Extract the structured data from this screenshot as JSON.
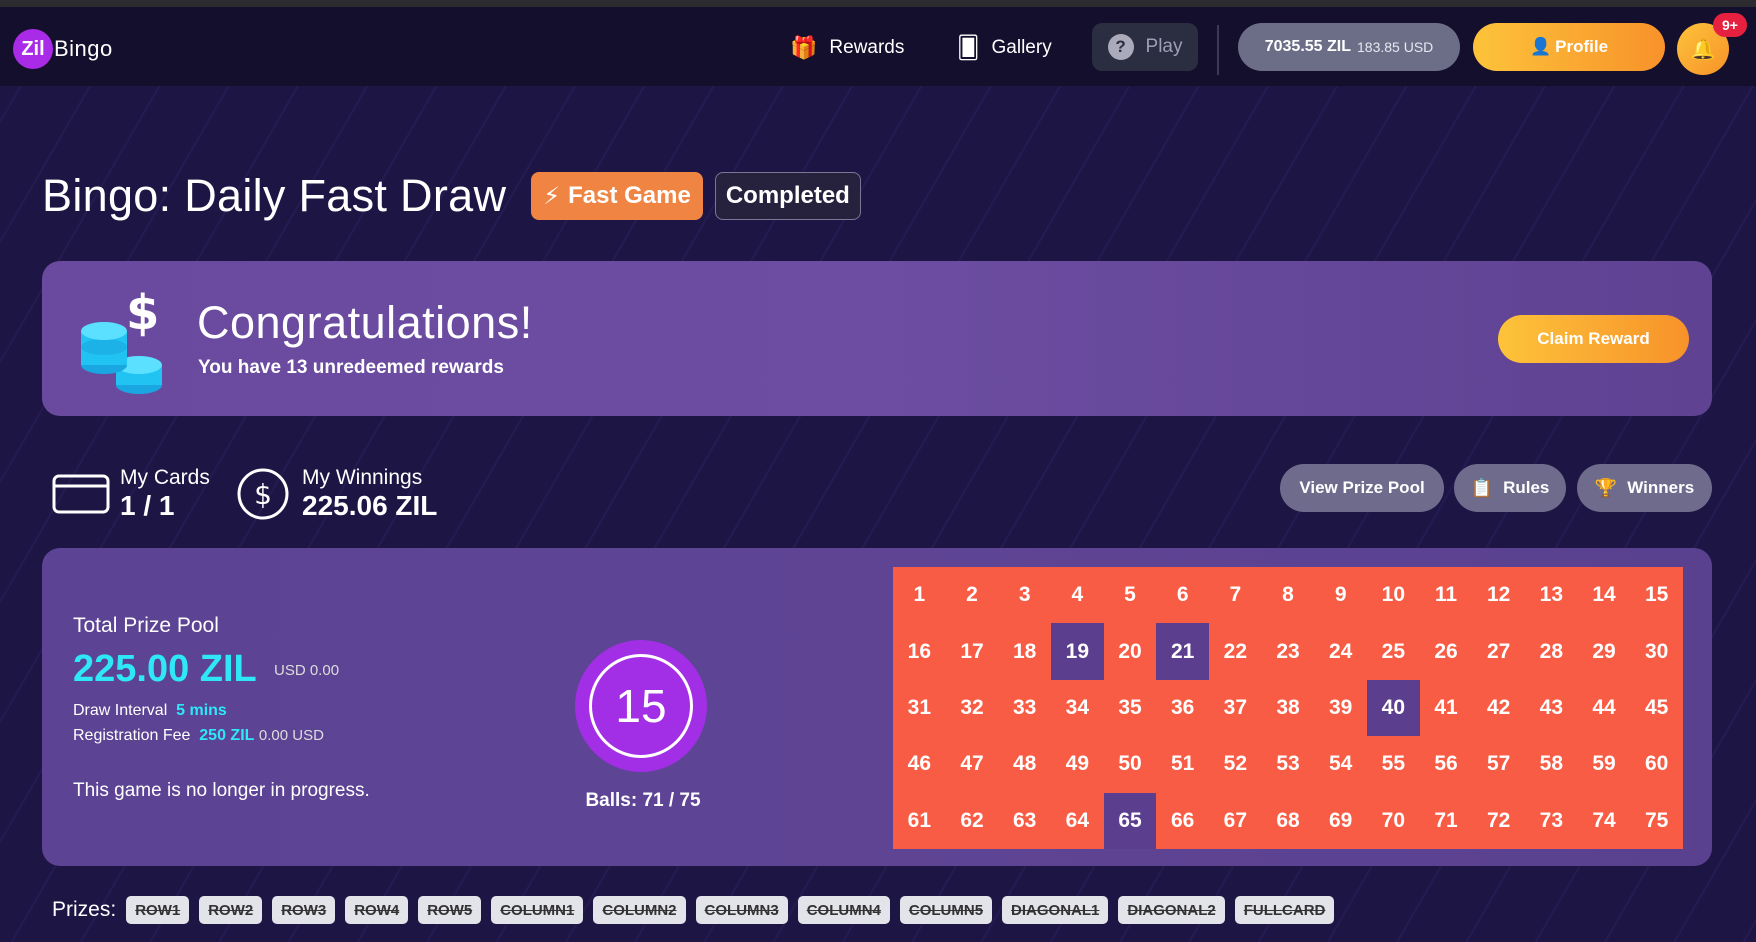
{
  "header": {
    "logo_prefix": "Zil",
    "logo_suffix": "Bingo",
    "nav": [
      {
        "label": "Rewards",
        "icon": "gift-icon"
      },
      {
        "label": "Gallery",
        "icon": "cards-icon"
      }
    ],
    "play_label": "Play",
    "balance_zil": "7035.55 ZIL",
    "balance_usd": "183.85 USD",
    "profile_label": "Profile",
    "notification_badge": "9+"
  },
  "page": {
    "title": "Bingo: Daily Fast Draw",
    "tag_fast": "Fast Game",
    "tag_status": "Completed"
  },
  "congrats": {
    "title": "Congratulations!",
    "subtitle": "You have 13 unredeemed rewards",
    "claim_label": "Claim Reward"
  },
  "stats": {
    "cards_label": "My Cards",
    "cards_value": "1 / 1",
    "winnings_label": "My Winnings",
    "winnings_value": "225.06 ZIL"
  },
  "actions": {
    "prize_pool_label": "View Prize Pool",
    "rules_label": "Rules",
    "winners_label": "Winners"
  },
  "game": {
    "pool_label": "Total Prize Pool",
    "pool_value": "225.00 ZIL",
    "pool_usd": "USD 0.00",
    "interval_label": "Draw Interval",
    "interval_value": "5 mins",
    "fee_label": "Registration Fee",
    "fee_value": "250 ZIL",
    "fee_usd": "0.00 USD",
    "status_text": "This game is no longer in progress.",
    "current_ball": "15",
    "balls_text": "Balls: 71 / 75",
    "board_numbers": [
      1,
      2,
      3,
      4,
      5,
      6,
      7,
      8,
      9,
      10,
      11,
      12,
      13,
      14,
      15,
      16,
      17,
      18,
      19,
      20,
      21,
      22,
      23,
      24,
      25,
      26,
      27,
      28,
      29,
      30,
      31,
      32,
      33,
      34,
      35,
      36,
      37,
      38,
      39,
      40,
      41,
      42,
      43,
      44,
      45,
      46,
      47,
      48,
      49,
      50,
      51,
      52,
      53,
      54,
      55,
      56,
      57,
      58,
      59,
      60,
      61,
      62,
      63,
      64,
      65,
      66,
      67,
      68,
      69,
      70,
      71,
      72,
      73,
      74,
      75
    ],
    "highlighted": [
      19,
      21,
      40,
      65
    ],
    "colors": {
      "board": "#f85c44",
      "highlight": "#5c3e8f",
      "accent": "#2ee7f7"
    }
  },
  "prizes": {
    "label": "Prizes:",
    "items": [
      "ROW1",
      "ROW2",
      "ROW3",
      "ROW4",
      "ROW5",
      "COLUMN1",
      "COLUMN2",
      "COLUMN3",
      "COLUMN4",
      "COLUMN5",
      "DIAGONAL1",
      "DIAGONAL2",
      "FULLCARD"
    ]
  }
}
